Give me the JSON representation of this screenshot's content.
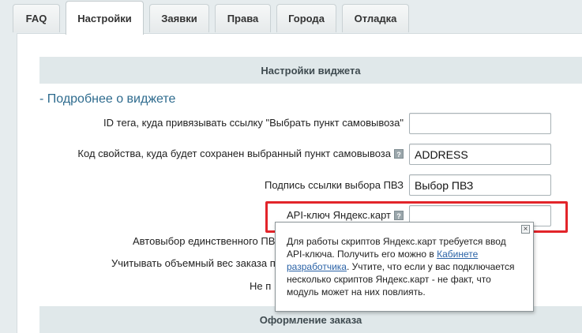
{
  "tabs": [
    {
      "label": "FAQ",
      "active": false
    },
    {
      "label": "Настройки",
      "active": true
    },
    {
      "label": "Заявки",
      "active": false
    },
    {
      "label": "Права",
      "active": false
    },
    {
      "label": "Города",
      "active": false
    },
    {
      "label": "Отладка",
      "active": false
    }
  ],
  "sections": {
    "widget_title": "Настройки виджета",
    "order_title": "Оформление заказа",
    "more_link": "- Подробнее о виджете"
  },
  "fields": {
    "tag_id": {
      "label": "ID тега, куда привязывать ссылку \"Выбрать пункт самовывоза\"",
      "value": ""
    },
    "property_code": {
      "label": "Код свойства, куда будет сохранен выбранный пункт самовывоза",
      "value": "ADDRESS"
    },
    "link_caption": {
      "label": "Подпись ссылки выбора ПВЗ",
      "value": "Выбор ПВЗ"
    },
    "api_key": {
      "label": "API-ключ Яндекс.карт",
      "value": ""
    }
  },
  "partial_labels": {
    "autoselect": "Автовыбор единственного ПВ",
    "volume_weight": "Учитывать объемный вес заказа п",
    "not": "Не п"
  },
  "tooltip": {
    "text_before_link": "Для работы скриптов Яндекс.карт требуется ввод API-ключа. Получить его можно в ",
    "link": "Кабинете разработчика",
    "text_after_link": ". Учтите, что если у вас подключается несколько скриптов Яндекс.карт - не факт, что модуль может на них повлиять.",
    "close": "×"
  },
  "icons": {
    "help": "?"
  },
  "colors": {
    "highlight": "#e2242a",
    "link": "#2a62a6",
    "section_bar": "#e0e8ea"
  }
}
